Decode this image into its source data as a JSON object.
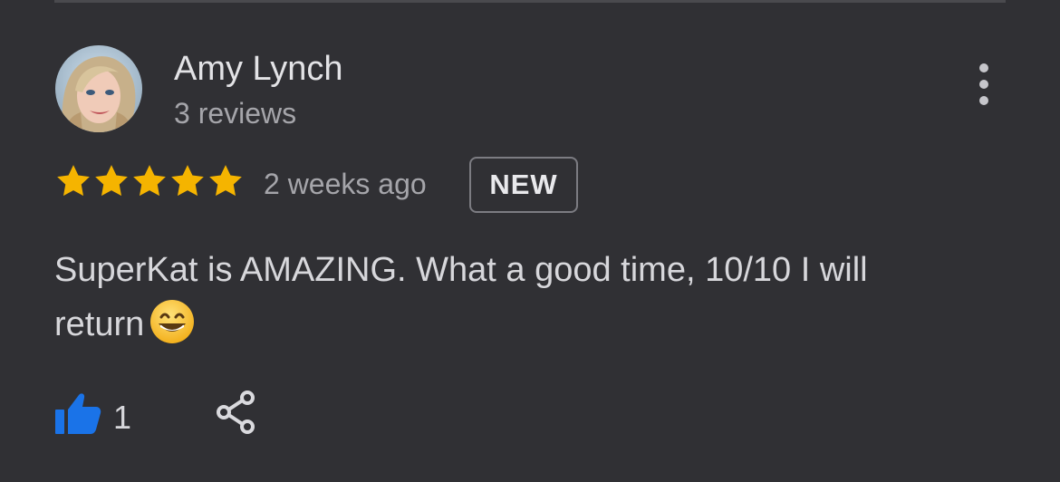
{
  "review": {
    "author_name": "Amy Lynch",
    "author_reviews": "3 reviews",
    "rating": 5,
    "rating_max": 5,
    "time": "2 weeks ago",
    "badge": "NEW",
    "text": "SuperKat is AMAZING. What a good time, 10/10 I will return",
    "emoji": "grinning-face",
    "likes": "1"
  },
  "icons": {
    "more": "more-vertical-icon",
    "like": "thumbs-up-icon",
    "share": "share-icon",
    "star": "star-icon"
  },
  "colors": {
    "background": "#303034",
    "star": "#f5b400",
    "like": "#1a73e8",
    "badge_border": "#7c7c82"
  }
}
